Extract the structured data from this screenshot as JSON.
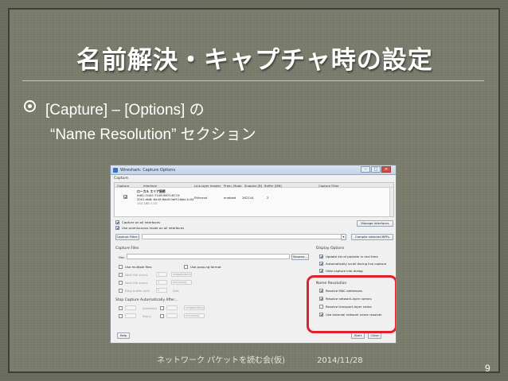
{
  "slide": {
    "title": "名前解決・キャプチャ時の設定",
    "bullet_line1": "[Capture] – [Options] の",
    "bullet_line2": "“Name Resolution” セクション",
    "footer_text": "ネットワーク パケットを読む会(仮)",
    "footer_date": "2014/11/28",
    "page_number": "9"
  },
  "dialog": {
    "window_title": "Wireshark: Capture Options",
    "capture_section": "Capture",
    "columns": [
      "Capture",
      "Interface",
      "Link-layer header",
      "Prom. Mode",
      "Snaplen [B]",
      "Buffer [MB]",
      "Capture Filter"
    ],
    "interface_row": {
      "name": "ローカル エリア接続",
      "addr1": "fe80::3402:7108:9870:6719",
      "addr2": "2001:db8::6a40:6da5:0bff:2bbb:1c04",
      "addr3": "192.168.1.10",
      "link_layer": "Ethernet",
      "prom_mode": "enabled",
      "snaplen": "262144",
      "buffer": "2"
    },
    "capture_all_label": "Capture on all interfaces",
    "promiscuous_label": "Use promiscuous mode on all interfaces",
    "manage_interfaces_btn": "Manage Interfaces",
    "capture_filter_btn": "Capture Filter:",
    "compile_bpf_btn": "Compile selected BPFs",
    "capture_files_section": "Capture Files",
    "file_label": "File:",
    "browse_btn": "Browse...",
    "multiple_files_label": "Use multiple files",
    "pcapng_label": "Use pcap-ng format",
    "next_file_every_1": "Next file every",
    "next_file_every_2": "Next file every",
    "ring_buffer_label": "Ring buffer with",
    "spin_1": "1",
    "spin_2": "1",
    "spin_3": "2",
    "unit_megabytes": "megabyte(s)",
    "unit_minutes": "minute(s)",
    "unit_files": "files",
    "display_options_section": "Display Options",
    "update_realtime_label": "Update list of packets in real time",
    "auto_scroll_label": "Automatically scroll during live capture",
    "hide_info_label": "Hide capture info dialog",
    "stop_capture_section": "Stop Capture Automatically After...",
    "stop_packets_unit": "packet(s)",
    "stop_files_unit": "file(s)",
    "stop_mb_unit": "megabyte(s)",
    "stop_minute_unit": "minute(s)",
    "name_resolution_section": "Name Resolution",
    "resolve_mac_label": "Resolve MAC addresses",
    "resolve_network_label": "Resolve network-layer names",
    "resolve_transport_label": "Resolve transport-layer name",
    "use_external_label": "Use external network name resolver",
    "help_btn": "Help",
    "start_btn": "Start",
    "close_btn": "Close"
  },
  "colors": {
    "highlight": "#e0212b",
    "slide_bg": "#7a7c6c"
  }
}
